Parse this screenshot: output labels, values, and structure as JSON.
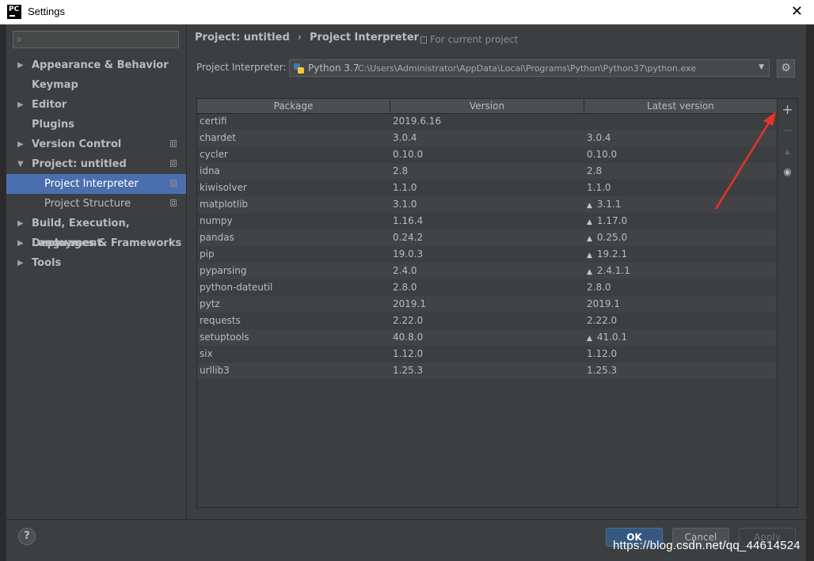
{
  "window": {
    "title": "Settings",
    "logo_text": "PC"
  },
  "sidebar": {
    "search": {
      "value": "",
      "placeholder": ""
    },
    "items": [
      {
        "label": "Appearance & Behavior",
        "expandable": true,
        "expanded": false,
        "copy_icon": false
      },
      {
        "label": "Keymap",
        "expandable": false,
        "copy_icon": false
      },
      {
        "label": "Editor",
        "expandable": true,
        "expanded": false,
        "copy_icon": false
      },
      {
        "label": "Plugins",
        "expandable": false,
        "copy_icon": false
      },
      {
        "label": "Version Control",
        "expandable": true,
        "expanded": false,
        "copy_icon": true
      },
      {
        "label": "Project: untitled",
        "expandable": true,
        "expanded": true,
        "copy_icon": true
      },
      {
        "label": "Project Interpreter",
        "sub": true,
        "selected": true,
        "copy_icon": true
      },
      {
        "label": "Project Structure",
        "sub": true,
        "copy_icon": true
      },
      {
        "label": "Build, Execution, Deployment",
        "expandable": true,
        "expanded": false,
        "copy_icon": false
      },
      {
        "label": "Languages & Frameworks",
        "expandable": true,
        "expanded": false,
        "copy_icon": false
      },
      {
        "label": "Tools",
        "expandable": true,
        "expanded": false,
        "copy_icon": false
      }
    ]
  },
  "main": {
    "breadcrumb": {
      "parent": "Project: untitled",
      "separator": "›",
      "current": "Project Interpreter"
    },
    "scope_note": "For current project",
    "interpreter": {
      "label": "Project Interpreter:",
      "name": "Python 3.7",
      "path": "C:\\Users\\Administrator\\AppData\\Local\\Programs\\Python\\Python37\\python.exe"
    },
    "table": {
      "columns": [
        "Package",
        "Version",
        "Latest version"
      ],
      "rows": [
        {
          "package": "certifi",
          "version": "2019.6.16",
          "latest": "",
          "upgrade": false
        },
        {
          "package": "chardet",
          "version": "3.0.4",
          "latest": "3.0.4",
          "upgrade": false
        },
        {
          "package": "cycler",
          "version": "0.10.0",
          "latest": "0.10.0",
          "upgrade": false
        },
        {
          "package": "idna",
          "version": "2.8",
          "latest": "2.8",
          "upgrade": false
        },
        {
          "package": "kiwisolver",
          "version": "1.1.0",
          "latest": "1.1.0",
          "upgrade": false
        },
        {
          "package": "matplotlib",
          "version": "3.1.0",
          "latest": "3.1.1",
          "upgrade": true
        },
        {
          "package": "numpy",
          "version": "1.16.4",
          "latest": "1.17.0",
          "upgrade": true
        },
        {
          "package": "pandas",
          "version": "0.24.2",
          "latest": "0.25.0",
          "upgrade": true
        },
        {
          "package": "pip",
          "version": "19.0.3",
          "latest": "19.2.1",
          "upgrade": true
        },
        {
          "package": "pyparsing",
          "version": "2.4.0",
          "latest": "2.4.1.1",
          "upgrade": true
        },
        {
          "package": "python-dateutil",
          "version": "2.8.0",
          "latest": "2.8.0",
          "upgrade": false
        },
        {
          "package": "pytz",
          "version": "2019.1",
          "latest": "2019.1",
          "upgrade": false
        },
        {
          "package": "requests",
          "version": "2.22.0",
          "latest": "2.22.0",
          "upgrade": false
        },
        {
          "package": "setuptools",
          "version": "40.8.0",
          "latest": "41.0.1",
          "upgrade": true
        },
        {
          "package": "six",
          "version": "1.12.0",
          "latest": "1.12.0",
          "upgrade": false
        },
        {
          "package": "urllib3",
          "version": "1.25.3",
          "latest": "1.25.3",
          "upgrade": false
        }
      ]
    },
    "tools": {
      "add": "+",
      "remove": "−",
      "upgrade": "▲",
      "show": "👁"
    }
  },
  "footer": {
    "help": "?",
    "ok": "OK",
    "cancel": "Cancel",
    "apply": "Apply"
  },
  "watermark": "https://blog.csdn.net/qq_44614524",
  "colors": {
    "accent": "#4b6eaf",
    "annotation": "#e8322c",
    "background": "#3c3f41"
  }
}
